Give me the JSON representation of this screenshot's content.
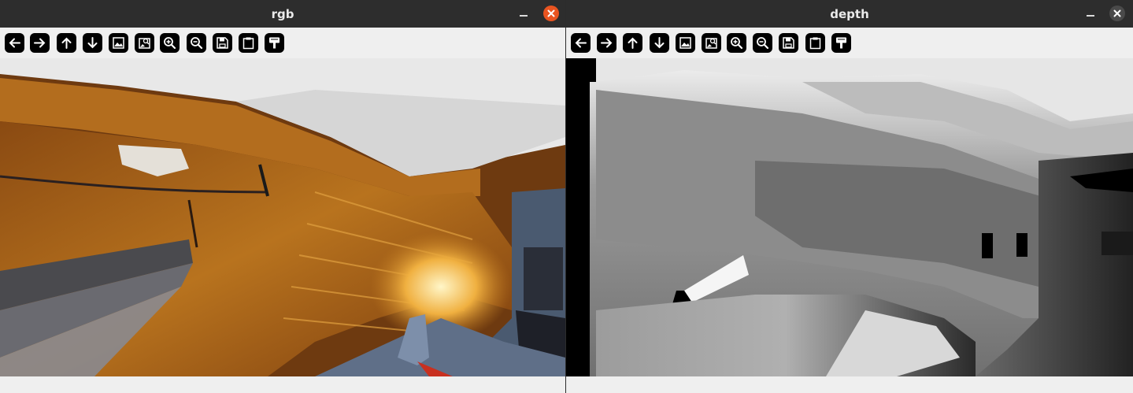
{
  "windows": {
    "rgb": {
      "title": "rgb",
      "toolbar": [
        {
          "name": "back-button",
          "icon": "arrow-left-icon"
        },
        {
          "name": "forward-button",
          "icon": "arrow-right-icon"
        },
        {
          "name": "pan-up-button",
          "icon": "arrow-up-icon"
        },
        {
          "name": "pan-down-button",
          "icon": "arrow-down-icon"
        },
        {
          "name": "zoom-image-button",
          "icon": "image-icon"
        },
        {
          "name": "zoom-original-button",
          "icon": "image-search-icon"
        },
        {
          "name": "zoom-in-button",
          "icon": "zoom-in-icon"
        },
        {
          "name": "zoom-out-button",
          "icon": "zoom-out-icon"
        },
        {
          "name": "save-button",
          "icon": "save-icon"
        },
        {
          "name": "copy-clipboard-button",
          "icon": "clipboard-icon"
        },
        {
          "name": "properties-button",
          "icon": "paint-brush-icon"
        }
      ],
      "status_text": ""
    },
    "depth": {
      "title": "depth",
      "status_text": ""
    }
  },
  "colors": {
    "titlebar": "#2d2d2d",
    "close_active": "#e95420",
    "close_inactive": "#4a4a4a",
    "toolbar_bg": "#efefef",
    "button_bg": "#000000"
  }
}
